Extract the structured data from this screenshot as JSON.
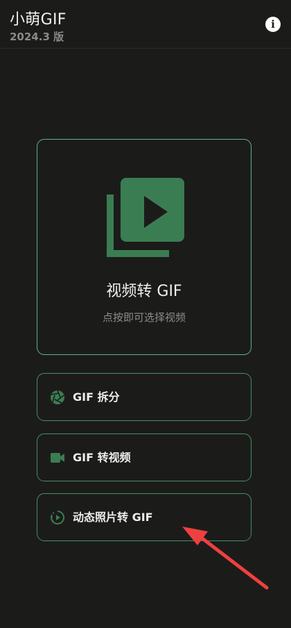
{
  "header": {
    "title": "小萌GIF",
    "version": "2024.3 版",
    "info_icon": "info-icon"
  },
  "hero": {
    "title": "视频转 GIF",
    "subtitle": "点按即可选择视频",
    "icon": "video-library-icon"
  },
  "actions": [
    {
      "label": "GIF 拆分",
      "icon": "aperture-icon"
    },
    {
      "label": "GIF 转视频",
      "icon": "videocam-icon"
    },
    {
      "label": "动态照片转 GIF",
      "icon": "motion-photo-icon"
    }
  ],
  "annotation": {
    "icon": "red-arrow-pointer"
  },
  "colors": {
    "background": "#1b1c1a",
    "accent": "#3b7d52",
    "border": "#5fb57f",
    "annotation": "#ee4040"
  }
}
